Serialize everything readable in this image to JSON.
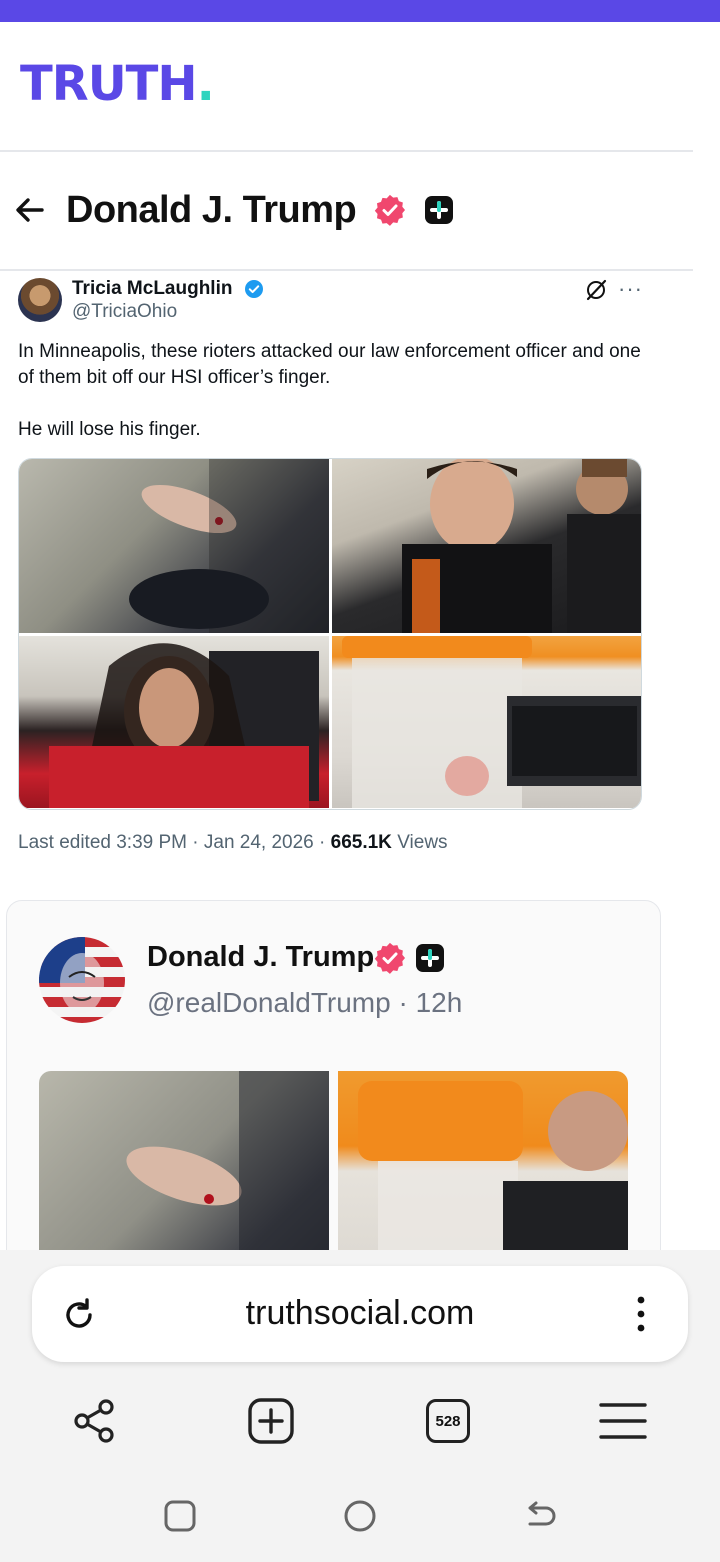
{
  "site": {
    "logo_text": "TRUTH",
    "logo_dot": "."
  },
  "header": {
    "title": "Donald J. Trump"
  },
  "tweet": {
    "author_name": "Tricia McLaughlin",
    "author_handle": "@TriciaOhio",
    "text_line1": "In Minneapolis, these rioters attacked our law enforcement officer and one of them bit off our HSI officer’s finger.",
    "text_line2": "He will lose his finger.",
    "meta_prefix": "Last edited 3:39 PM · Jan 24, 2026 · ",
    "views_count": "665.1K",
    "views_label": " Views",
    "more_label": "···"
  },
  "post": {
    "author_name": "Donald J. Trump",
    "author_handle": "@realDonaldTrump · 12h"
  },
  "browser": {
    "url": "truthsocial.com",
    "tab_count": "528"
  },
  "colors": {
    "brand": "#5a48e6",
    "accent": "#2dd4bf",
    "verified_badge": "#f0476e",
    "twitter_blue": "#1d9bf0"
  }
}
